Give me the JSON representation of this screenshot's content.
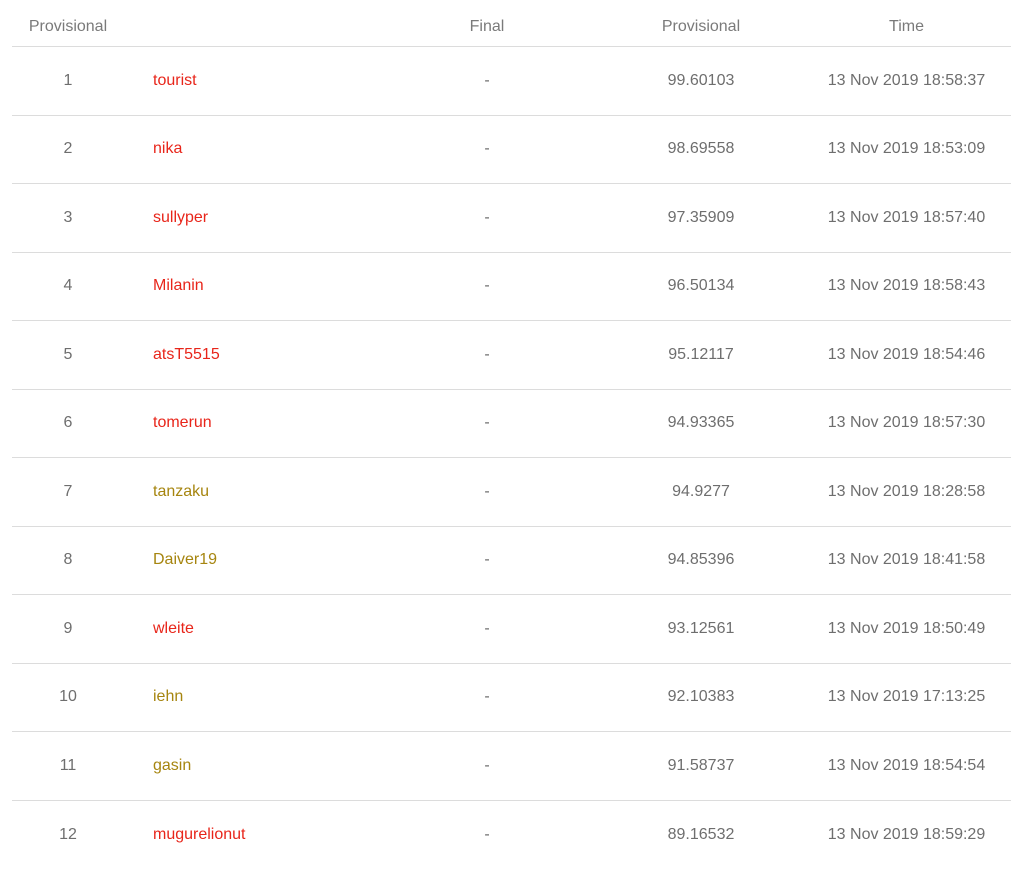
{
  "colors": {
    "red": "#e8251a",
    "yellow": "#a6850f",
    "header_text": "#7a7a7a",
    "cell_text": "#6e6e6e",
    "divider": "#dcdcdc"
  },
  "table": {
    "headers": {
      "rank": "Provisional",
      "handle": "",
      "final": "Final",
      "provisional": "Provisional",
      "time": "Time"
    },
    "rows": [
      {
        "rank": "1",
        "handle": "tourist",
        "color": "red",
        "final": "-",
        "provisional": "99.60103",
        "time": "13 Nov 2019 18:58:37"
      },
      {
        "rank": "2",
        "handle": "nika",
        "color": "red",
        "final": "-",
        "provisional": "98.69558",
        "time": "13 Nov 2019 18:53:09"
      },
      {
        "rank": "3",
        "handle": "sullyper",
        "color": "red",
        "final": "-",
        "provisional": "97.35909",
        "time": "13 Nov 2019 18:57:40"
      },
      {
        "rank": "4",
        "handle": "Milanin",
        "color": "red",
        "final": "-",
        "provisional": "96.50134",
        "time": "13 Nov 2019 18:58:43"
      },
      {
        "rank": "5",
        "handle": "atsT5515",
        "color": "red",
        "final": "-",
        "provisional": "95.12117",
        "time": "13 Nov 2019 18:54:46"
      },
      {
        "rank": "6",
        "handle": "tomerun",
        "color": "red",
        "final": "-",
        "provisional": "94.93365",
        "time": "13 Nov 2019 18:57:30"
      },
      {
        "rank": "7",
        "handle": "tanzaku",
        "color": "yellow",
        "final": "-",
        "provisional": "94.9277",
        "time": "13 Nov 2019 18:28:58"
      },
      {
        "rank": "8",
        "handle": "Daiver19",
        "color": "yellow",
        "final": "-",
        "provisional": "94.85396",
        "time": "13 Nov 2019 18:41:58"
      },
      {
        "rank": "9",
        "handle": "wleite",
        "color": "red",
        "final": "-",
        "provisional": "93.12561",
        "time": "13 Nov 2019 18:50:49"
      },
      {
        "rank": "10",
        "handle": "iehn",
        "color": "yellow",
        "final": "-",
        "provisional": "92.10383",
        "time": "13 Nov 2019 17:13:25"
      },
      {
        "rank": "11",
        "handle": "gasin",
        "color": "yellow",
        "final": "-",
        "provisional": "91.58737",
        "time": "13 Nov 2019 18:54:54"
      },
      {
        "rank": "12",
        "handle": "mugurelionut",
        "color": "red",
        "final": "-",
        "provisional": "89.16532",
        "time": "13 Nov 2019 18:59:29"
      }
    ]
  }
}
